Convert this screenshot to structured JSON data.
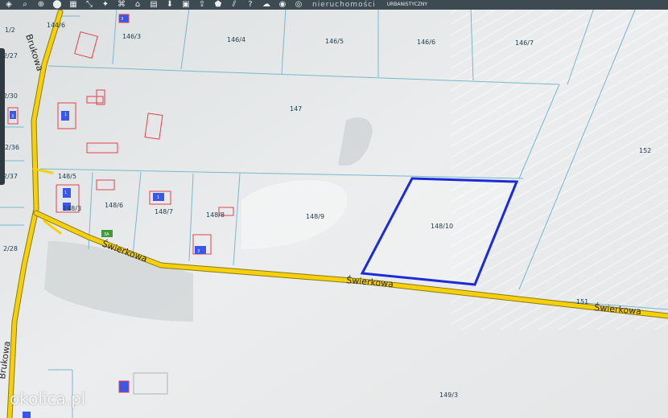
{
  "toolbar": {
    "buttons": [
      "layers-icon",
      "search-icon",
      "zoom-icon",
      "marker-icon",
      "print-icon",
      "measure-icon",
      "point-icon",
      "link-icon",
      "home-icon",
      "print2-icon",
      "save-icon",
      "photo-icon",
      "share-icon",
      "draw-icon",
      "chart-icon",
      "info-icon",
      "cloud-icon",
      "pin-icon",
      "globe-icon",
      "grid-icon",
      "settings-icon"
    ],
    "title_text": "nieruchomości",
    "sub_text": "URBANISTYCZNY"
  },
  "map": {
    "parcels": [
      "144/6",
      "146/3",
      "146/4",
      "146/5",
      "146/6",
      "146/7",
      "147",
      "152",
      "148/5",
      "148/6",
      "148/7",
      "148/8",
      "148/9",
      "148/10",
      "148/3",
      "149/3",
      "151",
      "1/2",
      "2/27",
      "2/30",
      "2/36",
      "2/37",
      "2/28"
    ],
    "roads": [
      "Brukowa",
      "Świerkowa",
      "Świerkowa",
      "Świerkowa",
      "Brukowa"
    ],
    "selected_parcel": "148/10",
    "building_labels": [
      "3",
      "1",
      "3",
      "1",
      "3",
      "1"
    ],
    "green_label": "3A",
    "colors": {
      "road": "#f6d10b",
      "selection": "#1b2bd8",
      "parcel_line": "#7ab8cc",
      "building": "#e0434b",
      "building_fill": "#3a57e8"
    }
  },
  "watermark": "okolica.pl"
}
